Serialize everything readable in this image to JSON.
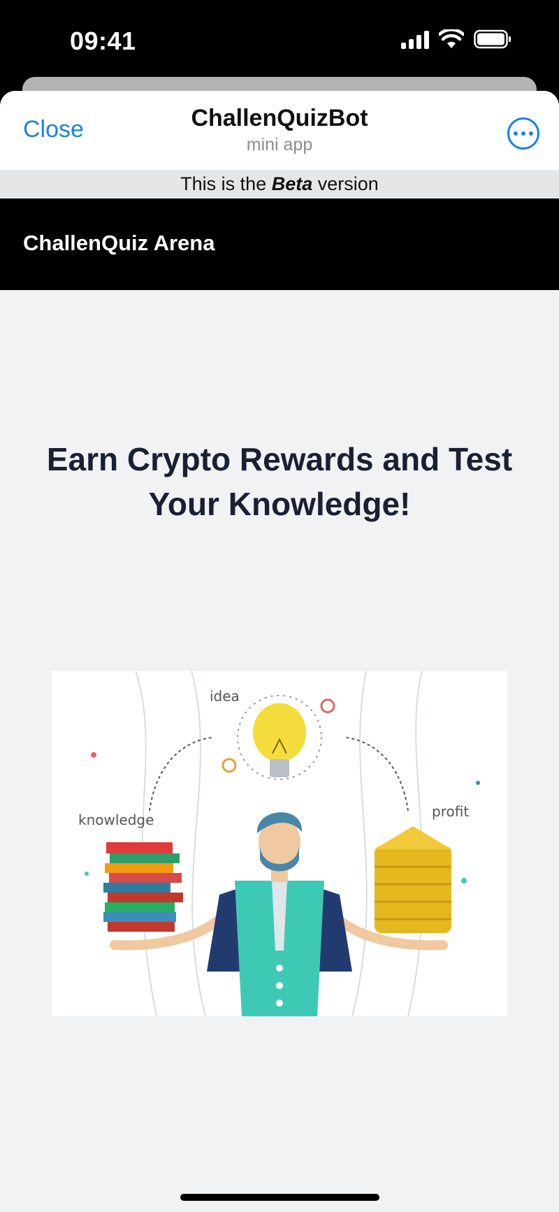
{
  "status_bar": {
    "time": "09:41"
  },
  "nav": {
    "close_label": "Close",
    "title": "ChallenQuizBot",
    "subtitle": "mini app",
    "more_icon": "more-horizontal-circle-icon"
  },
  "beta_banner": {
    "prefix": "This is the",
    "emphasis": "Beta",
    "suffix": "version"
  },
  "app_header": {
    "title": "ChallenQuiz Arena"
  },
  "hero": {
    "heading": "Earn Crypto Rewards and Test Your Knowledge!",
    "illustration_labels": {
      "left": "knowledge",
      "top": "idea",
      "right": "profit"
    }
  },
  "colors": {
    "accent": "#1a82e2",
    "page_background": "#f1f2f4",
    "header_background": "#000000",
    "heading_text": "#1a2033"
  }
}
